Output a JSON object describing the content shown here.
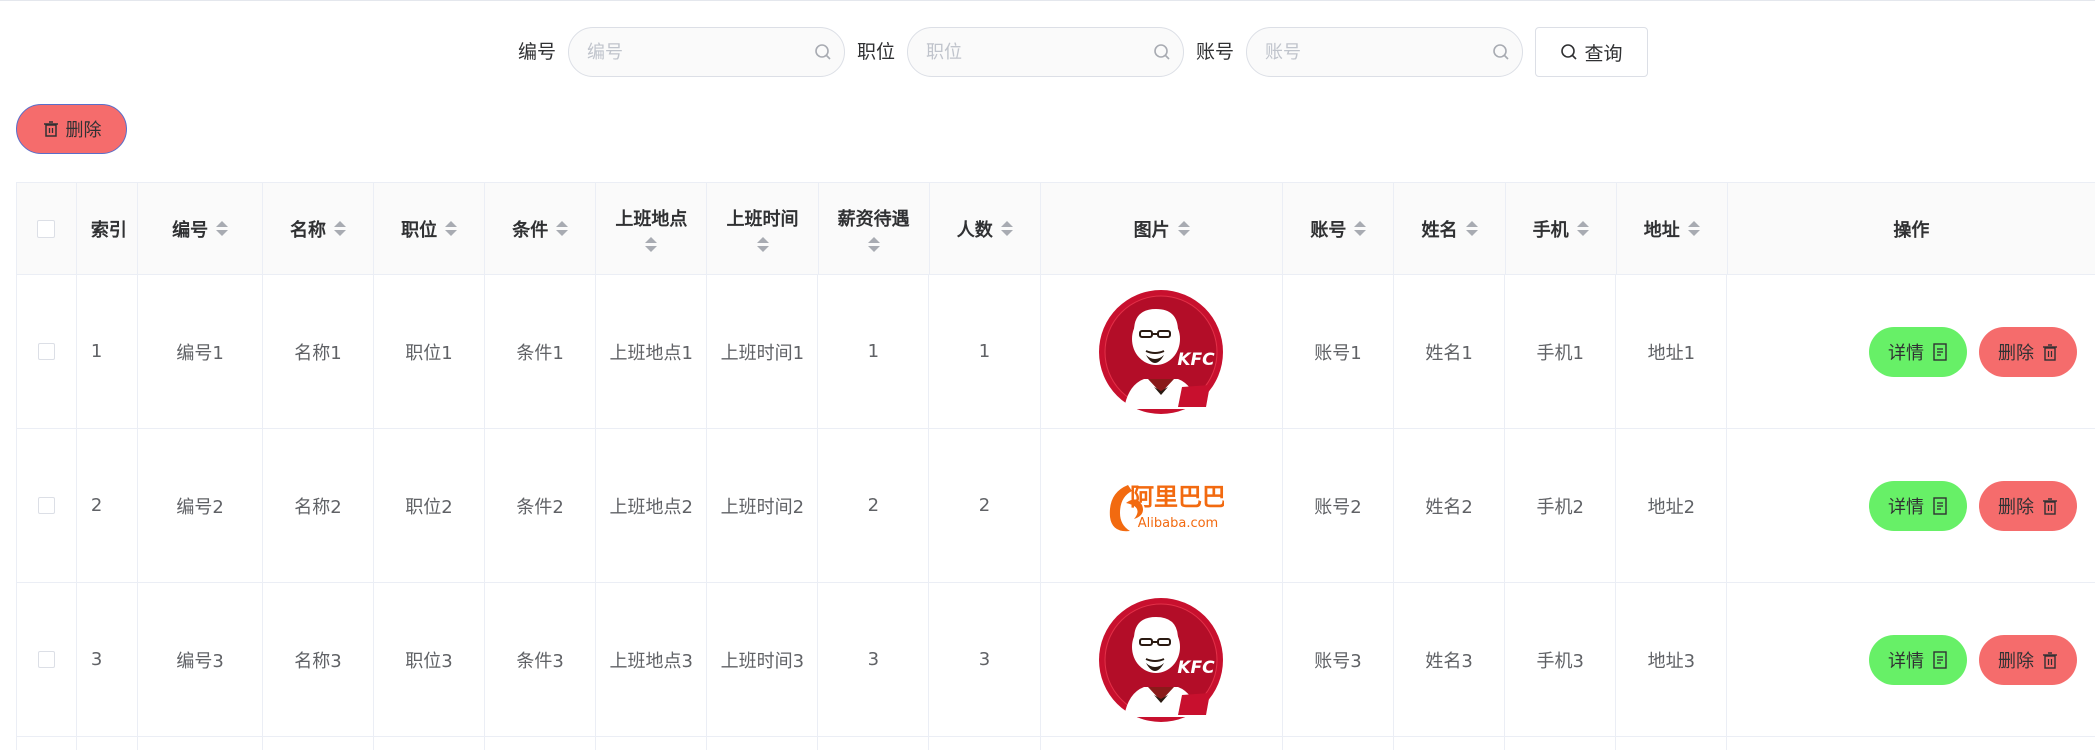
{
  "search": {
    "fields": [
      {
        "label": "编号",
        "placeholder": "编号"
      },
      {
        "label": "职位",
        "placeholder": "职位"
      },
      {
        "label": "账号",
        "placeholder": "账号"
      }
    ],
    "query_label": "查询"
  },
  "toolbar": {
    "delete_label": "删除"
  },
  "table": {
    "headers": {
      "index": "索引",
      "bh": "编号",
      "mc": "名称",
      "zw": "职位",
      "tj": "条件",
      "dd": "上班地点",
      "sj": "上班时间",
      "xz": "薪资待遇",
      "rs": "人数",
      "tp": "图片",
      "zh": "账号",
      "xm": "姓名",
      "sjh": "手机",
      "dz": "地址",
      "op": "操作"
    },
    "rows": [
      {
        "index": "1",
        "bh": "编号1",
        "mc": "名称1",
        "zw": "职位1",
        "tj": "条件1",
        "dd": "上班地点1",
        "sj": "上班时间1",
        "xz": "1",
        "rs": "1",
        "image": "kfc-logo",
        "zh": "账号1",
        "xm": "姓名1",
        "sjh": "手机1",
        "dz": "地址1"
      },
      {
        "index": "2",
        "bh": "编号2",
        "mc": "名称2",
        "zw": "职位2",
        "tj": "条件2",
        "dd": "上班地点2",
        "sj": "上班时间2",
        "xz": "2",
        "rs": "2",
        "image": "alibaba-logo",
        "zh": "账号2",
        "xm": "姓名2",
        "sjh": "手机2",
        "dz": "地址2"
      },
      {
        "index": "3",
        "bh": "编号3",
        "mc": "名称3",
        "zw": "职位3",
        "tj": "条件3",
        "dd": "上班地点3",
        "sj": "上班时间3",
        "xz": "3",
        "rs": "3",
        "image": "kfc-logo",
        "zh": "账号3",
        "xm": "姓名3",
        "sjh": "手机3",
        "dz": "地址3"
      }
    ],
    "detail_label": "详情",
    "delete_label": "删除"
  },
  "logos": {
    "kfc_text": "KFC",
    "alibaba_cn": "阿里巴巴",
    "alibaba_en": "Alibaba.com"
  },
  "colors": {
    "danger": "#f56c6c",
    "success": "#67f067",
    "border": "#ebeef5",
    "header_bg": "#fafafa"
  }
}
